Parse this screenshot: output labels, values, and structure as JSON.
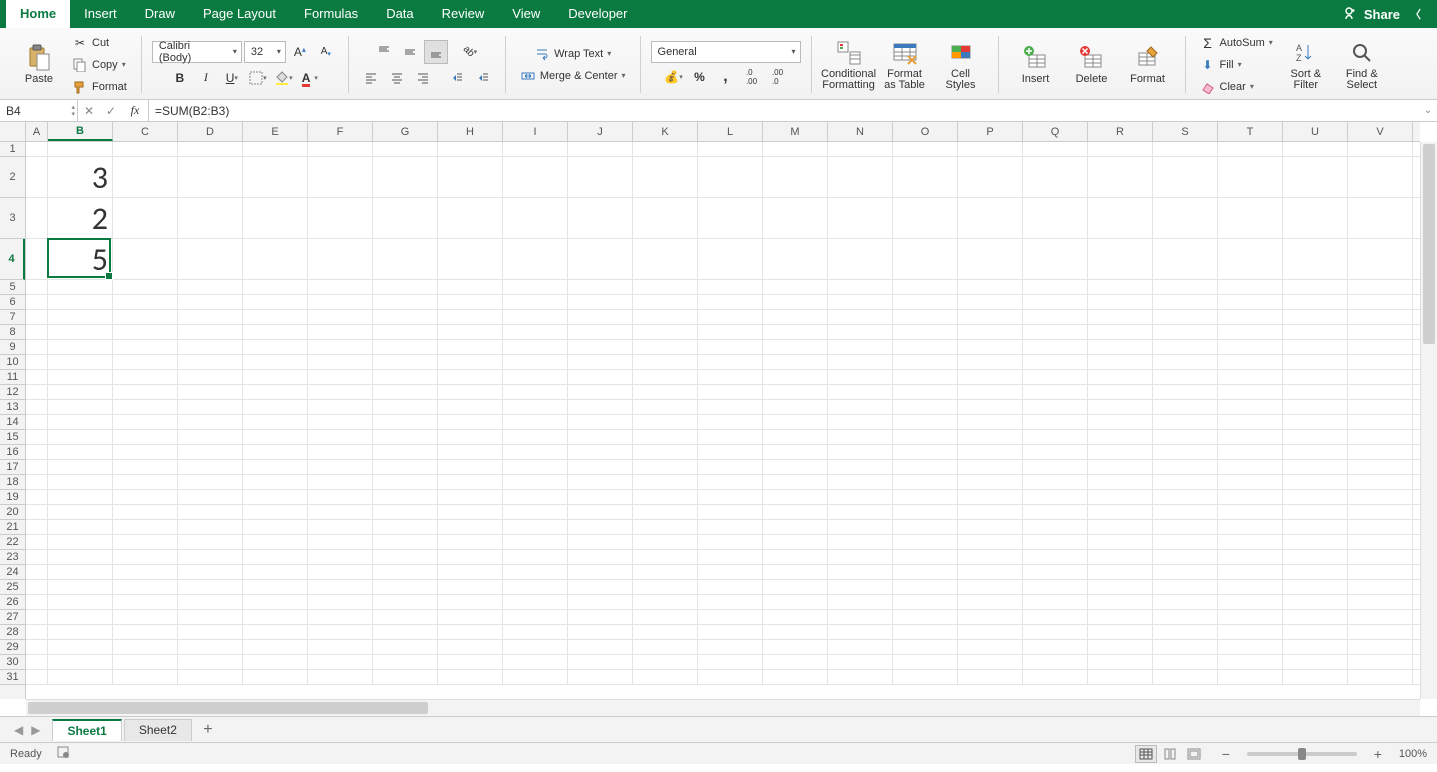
{
  "tabs": {
    "home": "Home",
    "insert": "Insert",
    "draw": "Draw",
    "page_layout": "Page Layout",
    "formulas": "Formulas",
    "data": "Data",
    "review": "Review",
    "view": "View",
    "developer": "Developer"
  },
  "share": "Share",
  "clipboard": {
    "paste": "Paste",
    "cut": "Cut",
    "copy": "Copy",
    "format": "Format"
  },
  "font": {
    "name": "Calibri (Body)",
    "size": "32"
  },
  "align": {
    "wrap": "Wrap Text",
    "merge": "Merge & Center"
  },
  "number": {
    "format": "General"
  },
  "styles": {
    "cond": "Conditional\nFormatting",
    "table": "Format\nas Table",
    "cell": "Cell\nStyles"
  },
  "cells": {
    "insert": "Insert",
    "delete": "Delete",
    "format": "Format"
  },
  "editing": {
    "autosum": "AutoSum",
    "fill": "Fill",
    "clear": "Clear",
    "sort": "Sort &\nFilter",
    "find": "Find &\nSelect"
  },
  "namebox": "B4",
  "formula": "=SUM(B2:B3)",
  "columns": [
    "A",
    "B",
    "C",
    "D",
    "E",
    "F",
    "G",
    "H",
    "I",
    "J",
    "K",
    "L",
    "M",
    "N",
    "O",
    "P",
    "Q",
    "R",
    "S",
    "T",
    "U",
    "V"
  ],
  "col_widths": {
    "default": 65,
    "A": 22,
    "B": 65
  },
  "rows": [
    1,
    2,
    3,
    4,
    5,
    6,
    7,
    8,
    9,
    10,
    11,
    12,
    13,
    14,
    15,
    16,
    17,
    18,
    19,
    20,
    21,
    22,
    23,
    24,
    25,
    26,
    27,
    28,
    29,
    30,
    31
  ],
  "row_heights": {
    "default": 15,
    "2": 41,
    "3": 41,
    "4": 41
  },
  "active": {
    "row": 4,
    "col": "B"
  },
  "data_cells": {
    "B2": "3",
    "B3": "2",
    "B4": "5"
  },
  "sheets": [
    "Sheet1",
    "Sheet2"
  ],
  "active_sheet": 0,
  "status": "Ready",
  "zoom": "100%"
}
